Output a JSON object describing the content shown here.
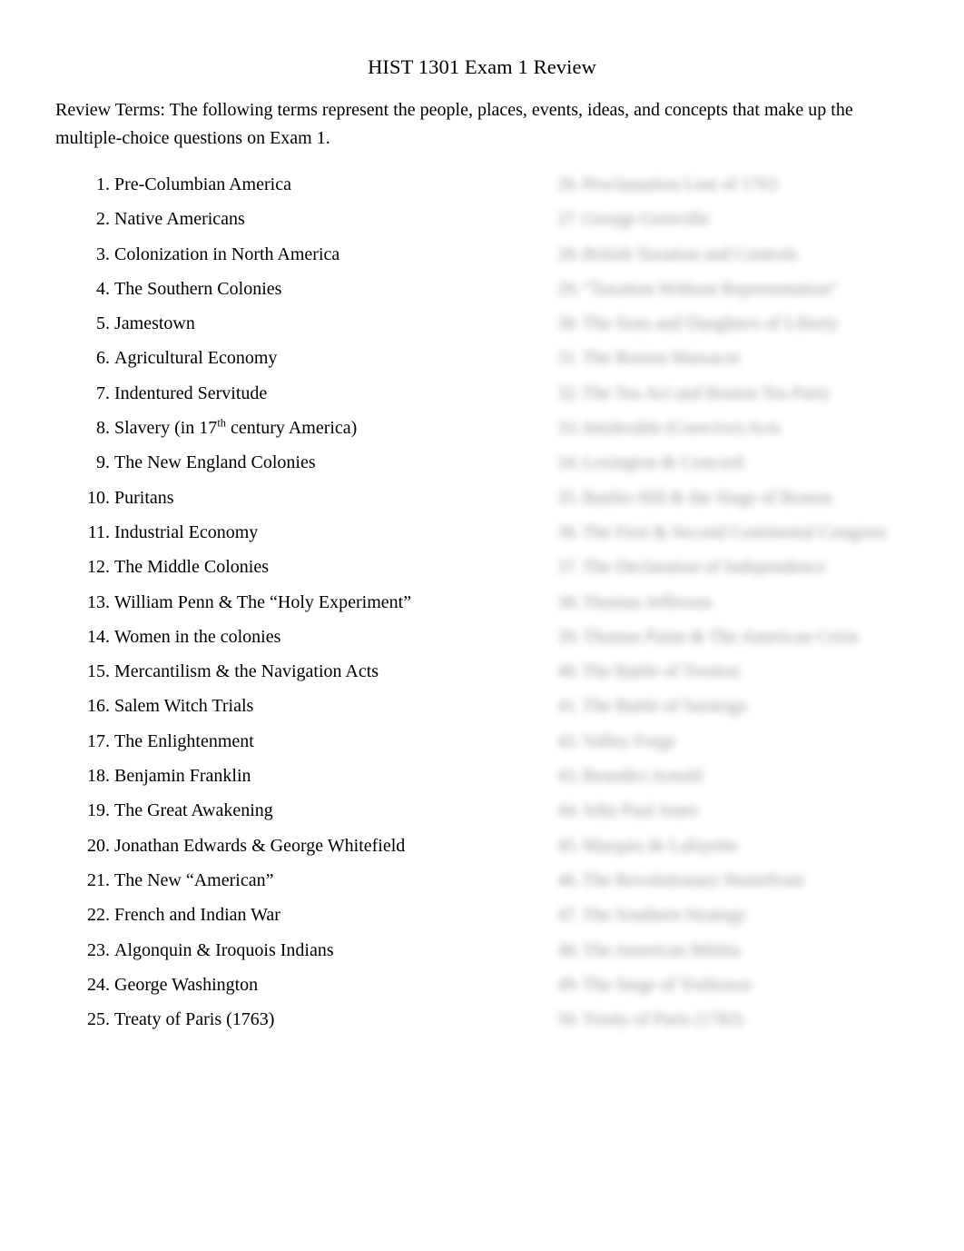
{
  "document": {
    "title": "HIST 1301 Exam 1 Review",
    "intro_label": "Review Terms:",
    "intro_text": "Review Terms:  The following terms represent the people, places, events, ideas, and concepts that make up the multiple-choice questions on Exam 1."
  },
  "left_column": [
    {
      "number": "1.",
      "text": "Pre-Columbian America"
    },
    {
      "number": "2.",
      "text": "Native Americans"
    },
    {
      "number": "3.",
      "text": "Colonization in North America"
    },
    {
      "number": "4.",
      "text": "The Southern Colonies"
    },
    {
      "number": "5.",
      "text": "Jamestown"
    },
    {
      "number": "6.",
      "text": "Agricultural Economy"
    },
    {
      "number": "7.",
      "text": "Indentured Servitude"
    },
    {
      "number": "8.",
      "text_before_sup": "Slavery (in 17",
      "sup": "th",
      "text_after_sup": " century America)"
    },
    {
      "number": "9.",
      "text": "The New England Colonies"
    },
    {
      "number": "10.",
      "text": "Puritans"
    },
    {
      "number": "11.",
      "text": "Industrial Economy"
    },
    {
      "number": "12.",
      "text": "The Middle Colonies"
    },
    {
      "number": "13.",
      "text": "William Penn & The “Holy Experiment”"
    },
    {
      "number": "14.",
      "text": "Women in the colonies"
    },
    {
      "number": "15.",
      "text": "Mercantilism & the Navigation Acts"
    },
    {
      "number": "16.",
      "text": "Salem Witch Trials"
    },
    {
      "number": "17.",
      "text": "The Enlightenment"
    },
    {
      "number": "18.",
      "text": "Benjamin Franklin"
    },
    {
      "number": "19.",
      "text": "The Great Awakening"
    },
    {
      "number": "20.",
      "text": "Jonathan Edwards & George Whitefield"
    },
    {
      "number": "21.",
      "text": "The New “American”"
    },
    {
      "number": "22.",
      "text": "French and Indian War"
    },
    {
      "number": "23.",
      "text": "Algonquin & Iroquois Indians"
    },
    {
      "number": "24.",
      "text": "George Washington"
    },
    {
      "number": "25.",
      "text": "Treaty of Paris (1763)"
    }
  ],
  "right_column": [
    {
      "number": "26.",
      "text": "Proclamation Line of 1763"
    },
    {
      "number": "27.",
      "text": "George Grenville"
    },
    {
      "number": "28.",
      "text": "British Taxation and Controls"
    },
    {
      "number": "29.",
      "text": "“Taxation Without Representation”"
    },
    {
      "number": "30.",
      "text": "The Sons and Daughters of Liberty"
    },
    {
      "number": "31.",
      "text": "The Boston Massacre"
    },
    {
      "number": "32.",
      "text": "The Tea Act and Boston Tea Party"
    },
    {
      "number": "33.",
      "text": "Intolerable (Coercive) Acts"
    },
    {
      "number": "34.",
      "text": "Lexington & Concord"
    },
    {
      "number": "35.",
      "text": "Battles Hill & the Siege of Boston"
    },
    {
      "number": "36.",
      "text": "The First & Second Continental Congress"
    },
    {
      "number": "37.",
      "text": "The Declaration of Independence"
    },
    {
      "number": "38.",
      "text": "Thomas Jefferson"
    },
    {
      "number": "39.",
      "text": "Thomas Paine & The American Crisis"
    },
    {
      "number": "40.",
      "text": "The Battle of Trenton"
    },
    {
      "number": "41.",
      "text": "The Battle of Saratoga"
    },
    {
      "number": "42.",
      "text": "Valley Forge"
    },
    {
      "number": "43.",
      "text": "Benedict Arnold"
    },
    {
      "number": "44.",
      "text": "John Paul Jones"
    },
    {
      "number": "45.",
      "text": "Marquis de Lafayette"
    },
    {
      "number": "46.",
      "text": "The Revolutionary Homefront"
    },
    {
      "number": "47.",
      "text": "The Southern Strategy"
    },
    {
      "number": "48.",
      "text": "The American Militia"
    },
    {
      "number": "49.",
      "text": "The Siege of Yorktown"
    },
    {
      "number": "50.",
      "text": "Treaty of Paris (1783)"
    }
  ]
}
